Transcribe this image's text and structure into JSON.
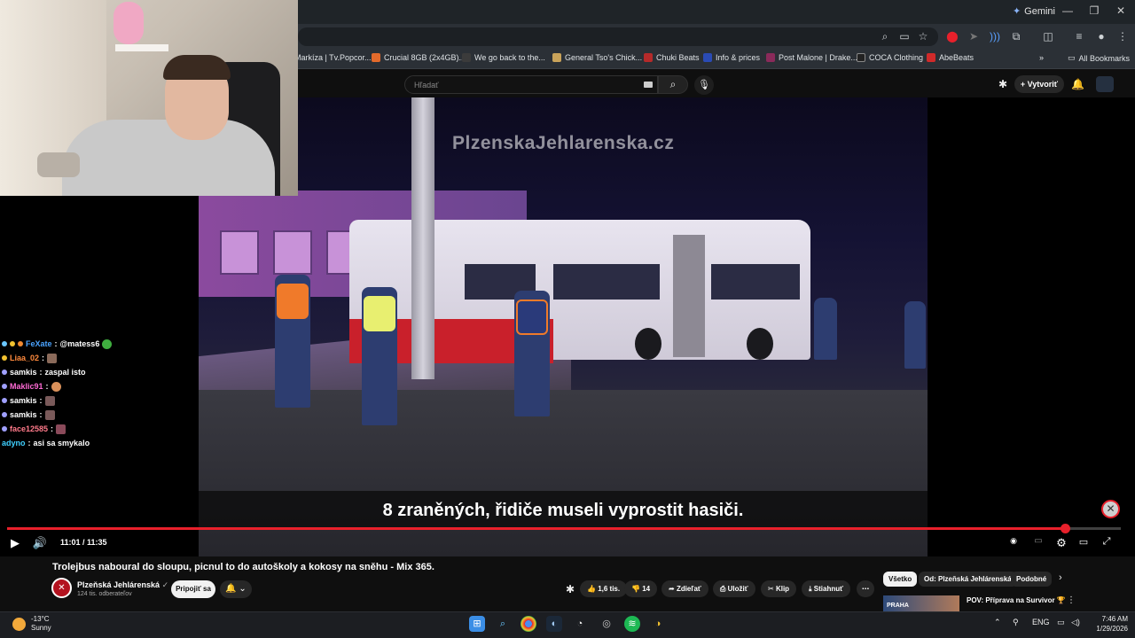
{
  "browser": {
    "gemini_label": "Gemini",
    "bookmarks": [
      {
        "label": "Markíza | Tv.Popcor...",
        "color": "#e34b4b"
      },
      {
        "label": "Crucial 8GB (2x4GB)...",
        "color": "#e36a2b"
      },
      {
        "label": "We go back to the...",
        "color": "#3b3b3b"
      },
      {
        "label": "General Tso's Chick...",
        "color": "#c9a35a"
      },
      {
        "label": "Chuki Beats",
        "color": "#b52a2a"
      },
      {
        "label": "Info & prices",
        "color": "#2a4bb5"
      },
      {
        "label": "Post Malone | Drake...",
        "color": "#8a2a5a"
      },
      {
        "label": "COCA Clothing",
        "color": "#222222"
      },
      {
        "label": "AbeBeats",
        "color": "#d12a2a"
      }
    ],
    "all_bookmarks": "All Bookmarks"
  },
  "youtube": {
    "search_placeholder": "Hľadať",
    "create_label": "Vytvoriť"
  },
  "video": {
    "watermark": "PlzenskaJehlarenska.cz",
    "subtitle": "8 zraněných, řidiče museli vyprostit hasiči.",
    "time": "11:01 / 11:35",
    "progress": 0.95
  },
  "chat": [
    {
      "user": "FeXate",
      "message": "@matess6",
      "color": "#4aa3ff",
      "emote": "#3fae3f"
    },
    {
      "user": "Liaa_02",
      "message": "",
      "color": "#ff8a3d",
      "emote": "#8a6a5a"
    },
    {
      "user": "samkis",
      "message": "zaspal isto",
      "color": "#ffffff",
      "emote": ""
    },
    {
      "user": "Maklic91",
      "message": "",
      "color": "#ff6ad5",
      "emote": "#d9905a"
    },
    {
      "user": "samkis",
      "message": "",
      "color": "#ffffff",
      "emote": "#7a5a5a"
    },
    {
      "user": "samkis",
      "message": "",
      "color": "#ffffff",
      "emote": "#7a5a5a"
    },
    {
      "user": "face12585",
      "message": "",
      "color": "#ff7a8a",
      "emote": "#8a4a5a"
    },
    {
      "user": "adyno",
      "message": "asi sa smykalo",
      "color": "#3fd0ff",
      "emote": ""
    }
  ],
  "watch": {
    "title": "Trolejbus naboural do sloupu, picnul to do autoškoly a kokosy na sněhu - Mix 365.",
    "channel": "Plzeňská Jehlárenská",
    "subscribers": "124 tis. odberateľov",
    "join_label": "Pripojiť sa",
    "likes": "1,6 tis.",
    "dislikes": "14",
    "share": "Zdieľať",
    "save": "Uložiť",
    "clip": "Klip",
    "download": "Stiahnuť"
  },
  "chips": [
    "Všetko",
    "Od: Plzeňská Jehlárenská",
    "Podobné"
  ],
  "recommendation": {
    "title": "POV: Příprava na Survivor 🏆",
    "thumb_text": "PRAHA"
  },
  "taskbar": {
    "temp": "-13°C",
    "weather": "Sunny",
    "lang": "ENG",
    "time": "7:46 AM",
    "date": "1/29/2026"
  }
}
